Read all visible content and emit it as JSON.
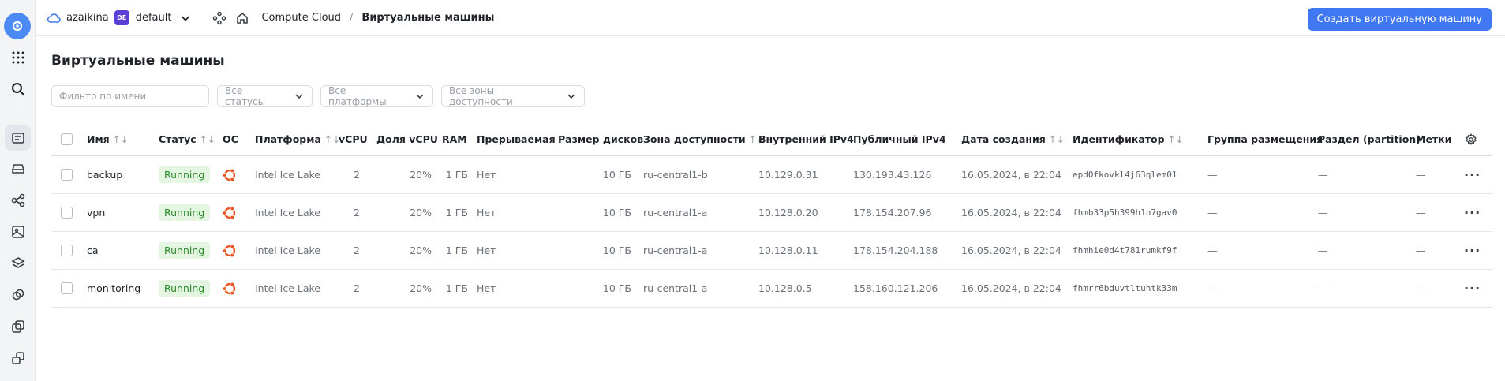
{
  "rail": {
    "icons": [
      "cloud-logo-icon",
      "apps-grid-icon",
      "search-icon",
      "vm-list-icon",
      "disk-icon",
      "network-icon",
      "image-icon",
      "layers-icon",
      "groups-icon",
      "snapshot-icon",
      "instances-icon"
    ]
  },
  "topbar": {
    "cloud": "azaikina",
    "folder_badge": "DE",
    "folder": "default",
    "breadcrumb_service": "Compute Cloud",
    "breadcrumb_sep": "/",
    "breadcrumb_current": "Виртуальные машины",
    "create_button": "Создать виртуальную машину"
  },
  "page": {
    "title": "Виртуальные машины"
  },
  "filters": {
    "name_placeholder": "Фильтр по имени",
    "status": "Все статусы",
    "platform": "Все платформы",
    "zone": "Все зоны доступности"
  },
  "table": {
    "columns": {
      "name": "Имя",
      "status": "Статус",
      "os": "ОС",
      "platform": "Платформа",
      "vcpu": "vCPU",
      "cpu_share": "Доля vCPU",
      "ram": "RAM",
      "preemptible": "Прерываемая",
      "disk_size": "Размер дисков",
      "zone": "Зона доступности",
      "internal_ip": "Внутренний IPv4",
      "public_ip": "Публичный IPv4",
      "created": "Дата создания",
      "id": "Идентификатор",
      "placement": "Группа размещения",
      "partition": "Раздел (partition)",
      "labels": "Метки"
    },
    "sort_glyph": "↑↓",
    "rows": [
      {
        "name": "backup",
        "status": "Running",
        "os": "ubuntu-icon",
        "platform": "Intel Ice Lake",
        "vcpu": "2",
        "cpu_share": "20%",
        "ram": "1 ГБ",
        "preemptible": "Нет",
        "disk_size": "10 ГБ",
        "zone": "ru-central1-b",
        "internal_ip": "10.129.0.31",
        "public_ip": "130.193.43.126",
        "created": "16.05.2024, в 22:04",
        "id": "epd0fkovkl4j63qlem01",
        "placement": "—",
        "partition": "—",
        "labels": "—"
      },
      {
        "name": "vpn",
        "status": "Running",
        "os": "ubuntu-icon",
        "platform": "Intel Ice Lake",
        "vcpu": "2",
        "cpu_share": "20%",
        "ram": "1 ГБ",
        "preemptible": "Нет",
        "disk_size": "10 ГБ",
        "zone": "ru-central1-a",
        "internal_ip": "10.128.0.20",
        "public_ip": "178.154.207.96",
        "created": "16.05.2024, в 22:04",
        "id": "fhmb33p5h399h1n7gav0",
        "placement": "—",
        "partition": "—",
        "labels": "—"
      },
      {
        "name": "ca",
        "status": "Running",
        "os": "ubuntu-icon",
        "platform": "Intel Ice Lake",
        "vcpu": "2",
        "cpu_share": "20%",
        "ram": "1 ГБ",
        "preemptible": "Нет",
        "disk_size": "10 ГБ",
        "zone": "ru-central1-a",
        "internal_ip": "10.128.0.11",
        "public_ip": "178.154.204.188",
        "created": "16.05.2024, в 22:04",
        "id": "fhmhie0d4t781rumkf9f",
        "placement": "—",
        "partition": "—",
        "labels": "—"
      },
      {
        "name": "monitoring",
        "status": "Running",
        "os": "ubuntu-icon",
        "platform": "Intel Ice Lake",
        "vcpu": "2",
        "cpu_share": "20%",
        "ram": "1 ГБ",
        "preemptible": "Нет",
        "disk_size": "10 ГБ",
        "zone": "ru-central1-a",
        "internal_ip": "10.128.0.5",
        "public_ip": "158.160.121.206",
        "created": "16.05.2024, в 22:04",
        "id": "fhmrr6bduvtltuhtk33m",
        "placement": "—",
        "partition": "—",
        "labels": "—"
      }
    ]
  },
  "colors": {
    "accent": "#3f78f2",
    "status_running_bg": "#e4f5e1",
    "status_running_fg": "#2a8a2a",
    "ubuntu": "#e95420",
    "folder_badge": "#5b3fd6"
  }
}
